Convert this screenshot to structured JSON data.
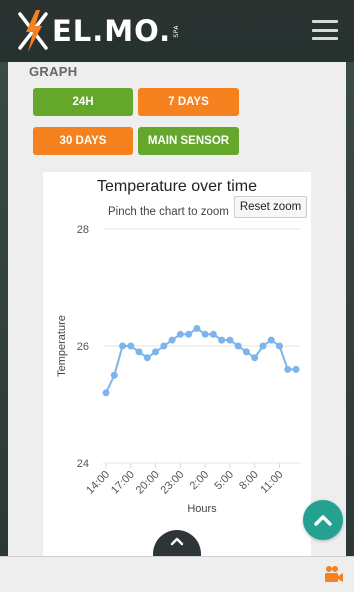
{
  "header": {
    "brand": "EL.MO.",
    "brand_suffix": "SPA",
    "menu_icon": "hamburger-menu-icon"
  },
  "graph": {
    "section_title": "GRAPH",
    "buttons": {
      "b24h": "24H",
      "b7days": "7 DAYS",
      "b30days": "30 DAYS",
      "main_sensor": "MAIN SENSOR"
    }
  },
  "colors": {
    "green": "#64a72b",
    "orange": "#f5811f",
    "teal": "#24a190",
    "line": "#7cb5ec"
  },
  "chart": {
    "reset_zoom": "Reset zoom"
  },
  "chart_data": {
    "type": "line",
    "title": "Temperature over time",
    "subtitle": "Pinch the chart to zoom",
    "xlabel": "Hours",
    "ylabel": "Temperature",
    "ylim": [
      24,
      28
    ],
    "y_ticks": [
      24,
      26,
      28
    ],
    "x_tick_labels": [
      "14:00",
      "17:00",
      "20:00",
      "23:00",
      "2:00",
      "5:00",
      "8:00",
      "11:00"
    ],
    "grid": true,
    "legend": "none",
    "series": [
      {
        "x": [
          "14:00",
          "15:00",
          "16:00",
          "17:00",
          "18:00",
          "19:00",
          "20:00",
          "21:00",
          "22:00",
          "23:00",
          "0:00",
          "1:00",
          "2:00",
          "3:00",
          "4:00",
          "5:00",
          "6:00",
          "7:00",
          "8:00",
          "9:00",
          "10:00",
          "11:00",
          "12:00",
          "13:00"
        ],
        "values": [
          25.2,
          25.5,
          26.0,
          26.0,
          25.9,
          25.8,
          25.9,
          26.0,
          26.1,
          26.2,
          26.2,
          26.3,
          26.2,
          26.2,
          26.1,
          26.1,
          26.0,
          25.9,
          25.8,
          26.0,
          26.1,
          26.0,
          25.6,
          25.6
        ]
      }
    ]
  },
  "icons": {
    "scroll_top": "chevron-up-icon",
    "pull_tab": "chevron-up-icon",
    "camera": "video-camera-icon"
  }
}
